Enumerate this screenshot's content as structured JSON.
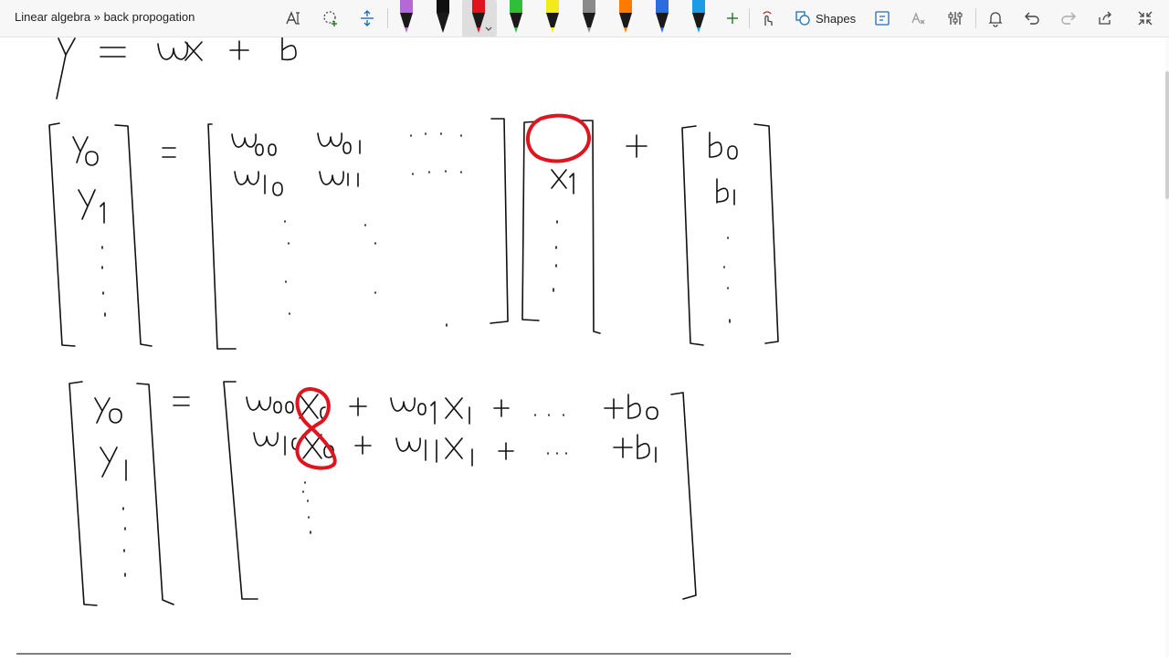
{
  "page": {
    "breadcrumb": "Linear algebra » back propogation"
  },
  "toolbar": {
    "shapes_label": "Shapes",
    "pens": [
      {
        "name": "purple-highlighter",
        "color": "#b36ad6"
      },
      {
        "name": "black-pen-1",
        "color": "#111111"
      },
      {
        "name": "red-pen",
        "color": "#e0141e",
        "selected": true
      },
      {
        "name": "green-pen",
        "color": "#2fbf3a"
      },
      {
        "name": "yellow-highlighter",
        "color": "#f3ea1a"
      },
      {
        "name": "gray-pen",
        "color": "#8a8a8a"
      },
      {
        "name": "rainbow-pen",
        "color": "#ff7b00"
      },
      {
        "name": "galaxy-pen",
        "color": "#2d6cdf"
      },
      {
        "name": "blue-pen",
        "color": "#1e9be6"
      }
    ],
    "accent_color": "#2f7d31"
  },
  "canvas": {
    "ink_color": "#111111",
    "highlight_color": "#e0141e"
  }
}
